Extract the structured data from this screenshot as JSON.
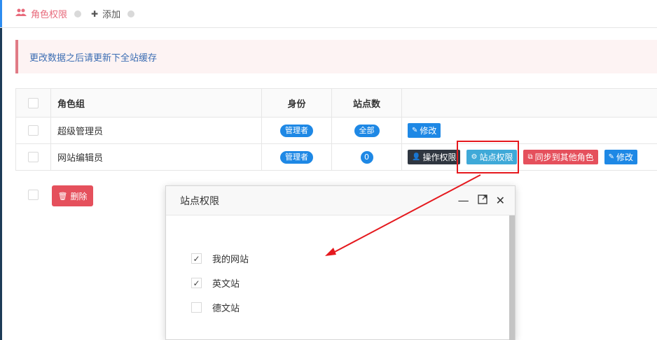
{
  "tabs": [
    {
      "icon": "users-icon",
      "glyph": "👥",
      "label": "角色权限"
    },
    {
      "icon": "plus-icon",
      "glyph": "✚",
      "label": "添加"
    }
  ],
  "alert": {
    "text": "更改数据之后请更新下全站缓存"
  },
  "table": {
    "headers": [
      "角色组",
      "身份",
      "站点数"
    ],
    "rows": [
      {
        "name": "超级管理员",
        "role": "管理者",
        "sites": "全部",
        "edit": "修改"
      },
      {
        "name": "网站编辑员",
        "role": "管理者",
        "sites": "0",
        "ops": "操作权限",
        "site_perm": "站点权限",
        "sync": "同步到其他角色",
        "edit": "修改"
      }
    ]
  },
  "delete_label": "删除",
  "modal": {
    "title": "站点权限",
    "options": [
      {
        "label": "我的网站",
        "checked": true
      },
      {
        "label": "英文站",
        "checked": true
      },
      {
        "label": "德文站",
        "checked": false
      }
    ]
  },
  "colors": {
    "accent": "#1e88e5",
    "danger": "#e5505c",
    "annotation": "#e5191e"
  }
}
